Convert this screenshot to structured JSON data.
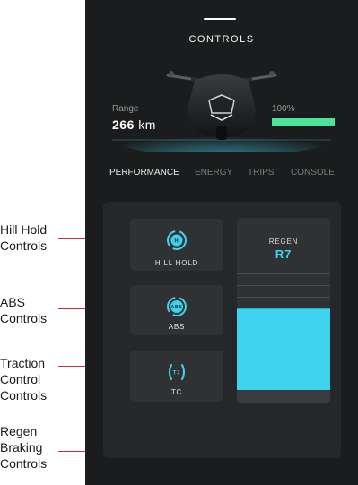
{
  "annotations": {
    "hill_hold": "Hill Hold Controls",
    "abs": "ABS Controls",
    "traction": "Traction Control Controls",
    "regen": "Regen Braking Controls"
  },
  "header": {
    "title": "CONTROLS"
  },
  "stats": {
    "range_label": "Range",
    "range_value": "266",
    "range_unit": "km",
    "battery_label": "100%",
    "battery_level": 1.0
  },
  "tabs": [
    {
      "label": "PERFORMANCE",
      "active": true
    },
    {
      "label": "ENERGY",
      "active": false
    },
    {
      "label": "TRIPS",
      "active": false
    },
    {
      "label": "CONSOLE",
      "active": false
    }
  ],
  "controls": {
    "hill_hold": {
      "icon_text": "H",
      "label": "HILL HOLD"
    },
    "abs": {
      "icon_text": "ABS",
      "label": "ABS"
    },
    "tc": {
      "icon_text": "T3",
      "label": "TC"
    }
  },
  "regen": {
    "label": "REGEN",
    "value": "R7",
    "segments_total": 10,
    "segments_active": 7
  },
  "colors": {
    "accent": "#3ed3ee",
    "battery": "#4ee39a",
    "annotation_line": "#d8283a",
    "panel": "#1b1c1d"
  }
}
